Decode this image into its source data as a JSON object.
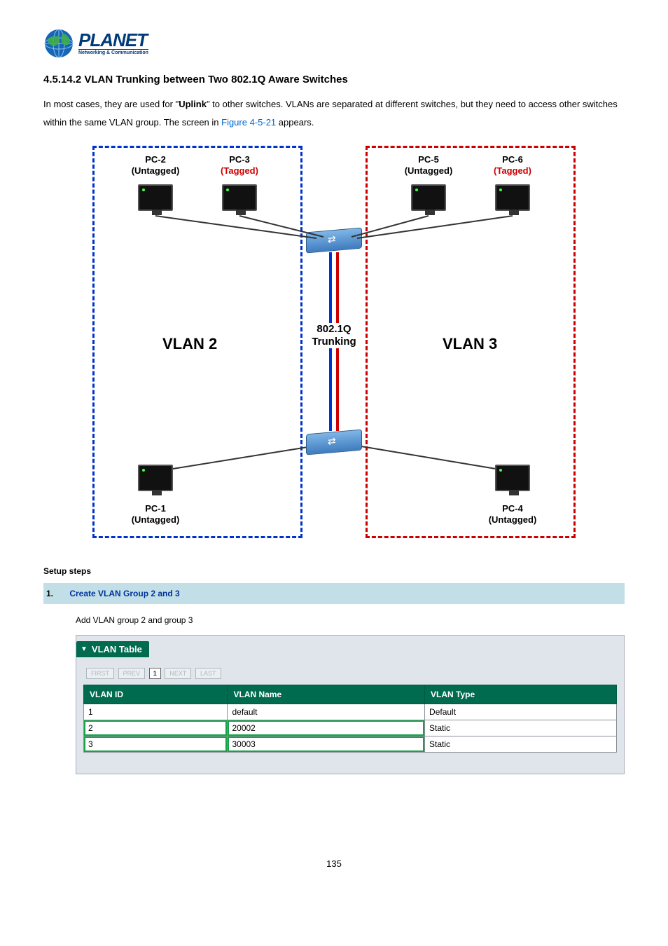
{
  "logo": {
    "brand": "PLANET",
    "tagline": "Networking & Communication"
  },
  "section": {
    "title": "4.5.14.2 VLAN Trunking between Two 802.1Q Aware Switches"
  },
  "para": {
    "pre": "In most cases, they are used for \"",
    "boldword": "Uplink",
    "mid": "\" to other switches. VLANs are separated at different switches, but they need to access other switches within the same VLAN group. The screen in ",
    "figref": "Figure 4-5-21",
    "post": " appears."
  },
  "diagram": {
    "pc2": {
      "name": "PC-2",
      "tag": "(Untagged)"
    },
    "pc3": {
      "name": "PC-3",
      "tag": "(Tagged)"
    },
    "pc5": {
      "name": "PC-5",
      "tag": "(Untagged)"
    },
    "pc6": {
      "name": "PC-6",
      "tag": "(Tagged)"
    },
    "pc1": {
      "name": "PC-1",
      "tag": "(Untagged)"
    },
    "pc4": {
      "name": "PC-4",
      "tag": "(Untagged)"
    },
    "vlan2": "VLAN 2",
    "vlan3": "VLAN 3",
    "trunk1": "802.1Q",
    "trunk2": "Trunking"
  },
  "setup": {
    "heading": "Setup steps",
    "step_num": "1.",
    "step_title": "Create VLAN Group 2 and 3",
    "step_body": "Add VLAN group 2 and group 3"
  },
  "vlan_table": {
    "title": "VLAN Table",
    "pager": {
      "first": "FIRST",
      "prev": "PREV",
      "page": "1",
      "next": "NEXT",
      "last": "LAST"
    },
    "headers": {
      "id": "VLAN ID",
      "name": "VLAN Name",
      "type": "VLAN Type"
    },
    "rows": [
      {
        "id": "1",
        "name": "default",
        "type": "Default",
        "hl": false
      },
      {
        "id": "2",
        "name": "20002",
        "type": "Static",
        "hl": true
      },
      {
        "id": "3",
        "name": "30003",
        "type": "Static",
        "hl": true
      }
    ]
  },
  "page_num": "135"
}
